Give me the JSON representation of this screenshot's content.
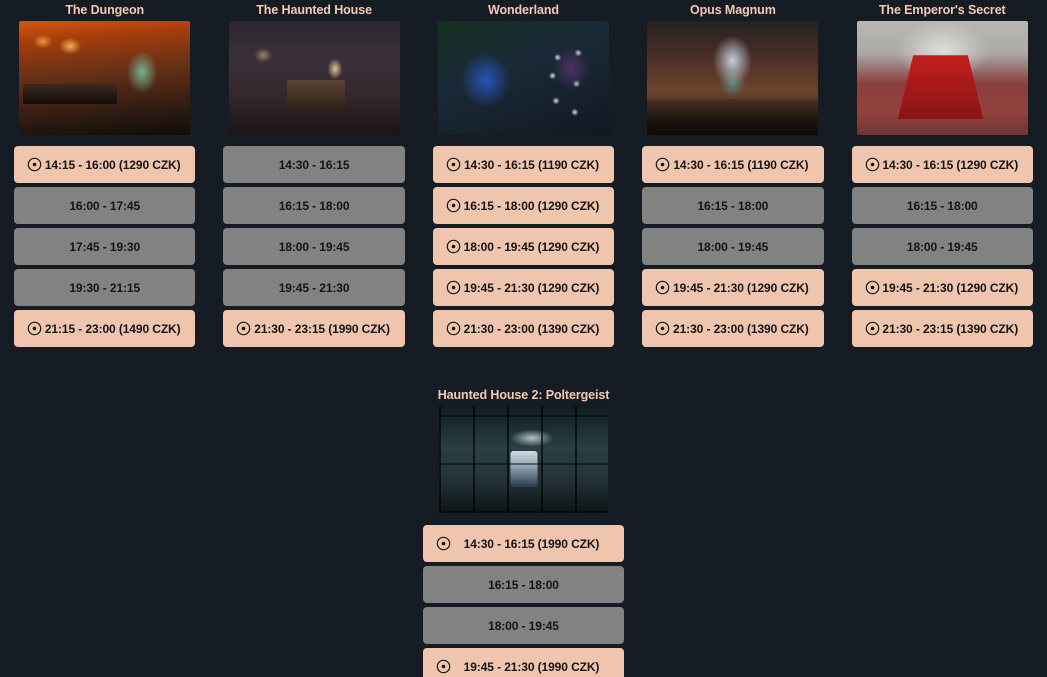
{
  "theme": {
    "background": "#151c24",
    "title_color": "#f4cab5",
    "slot_available_bg": "#f0c5ae",
    "slot_unavailable_bg": "#828282",
    "slot_text_color": "#141414"
  },
  "icons": {
    "available": "clock-icon"
  },
  "rooms": [
    {
      "title": "The Dungeon",
      "thumb_class": "th-dungeon",
      "thumb_name": "room-thumbnail-the-dungeon",
      "slots": [
        {
          "label": "14:15 - 16:00 (1290 CZK)",
          "available": true
        },
        {
          "label": "16:00 - 17:45",
          "available": false
        },
        {
          "label": "17:45 - 19:30",
          "available": false
        },
        {
          "label": "19:30 - 21:15",
          "available": false
        },
        {
          "label": "21:15 - 23:00 (1490 CZK)",
          "available": true
        }
      ]
    },
    {
      "title": "The Haunted House",
      "thumb_class": "th-haunted",
      "thumb_name": "room-thumbnail-the-haunted-house",
      "slots": [
        {
          "label": "14:30 - 16:15",
          "available": false
        },
        {
          "label": "16:15 - 18:00",
          "available": false
        },
        {
          "label": "18:00 - 19:45",
          "available": false
        },
        {
          "label": "19:45 - 21:30",
          "available": false
        },
        {
          "label": "21:30 - 23:15 (1990 CZK)",
          "available": true
        }
      ]
    },
    {
      "title": "Wonderland",
      "thumb_class": "th-wonder",
      "thumb_name": "room-thumbnail-wonderland",
      "slots": [
        {
          "label": "14:30 - 16:15 (1190 CZK)",
          "available": true
        },
        {
          "label": "16:15 - 18:00 (1290 CZK)",
          "available": true
        },
        {
          "label": "18:00 - 19:45 (1290 CZK)",
          "available": true
        },
        {
          "label": "19:45 - 21:30 (1290 CZK)",
          "available": true
        },
        {
          "label": "21:30 - 23:00 (1390 CZK)",
          "available": true
        }
      ]
    },
    {
      "title": "Opus Magnum",
      "thumb_class": "th-opus",
      "thumb_name": "room-thumbnail-opus-magnum",
      "slots": [
        {
          "label": "14:30 - 16:15 (1190 CZK)",
          "available": true
        },
        {
          "label": "16:15 - 18:00",
          "available": false
        },
        {
          "label": "18:00 - 19:45",
          "available": false
        },
        {
          "label": "19:45 - 21:30 (1290 CZK)",
          "available": true
        },
        {
          "label": "21:30 - 23:00 (1390 CZK)",
          "available": true
        }
      ]
    },
    {
      "title": "The Emperor's Secret",
      "thumb_class": "th-emperor",
      "thumb_name": "room-thumbnail-the-emperors-secret",
      "slots": [
        {
          "label": "14:30 - 16:15 (1290 CZK)",
          "available": true
        },
        {
          "label": "16:15 - 18:00",
          "available": false
        },
        {
          "label": "18:00 - 19:45",
          "available": false
        },
        {
          "label": "19:45 - 21:30 (1290 CZK)",
          "available": true
        },
        {
          "label": "21:30 - 23:15 (1390 CZK)",
          "available": true
        }
      ]
    }
  ],
  "bottom_room": {
    "title": "Haunted House 2: Poltergeist",
    "thumb_class": "th-poltergeist",
    "thumb_name": "room-thumbnail-haunted-house-2-poltergeist",
    "slots": [
      {
        "label": "14:30 - 16:15 (1990 CZK)",
        "available": true
      },
      {
        "label": "16:15 - 18:00",
        "available": false
      },
      {
        "label": "18:00 - 19:45",
        "available": false
      },
      {
        "label": "19:45 - 21:30 (1990 CZK)",
        "available": true
      }
    ]
  }
}
